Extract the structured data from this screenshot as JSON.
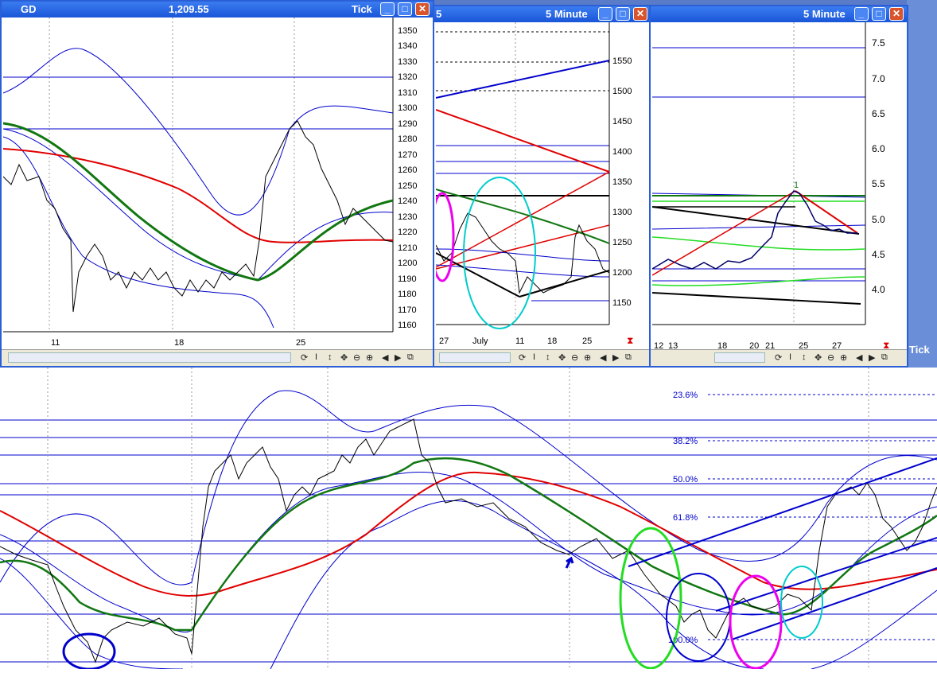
{
  "window1": {
    "symbol": "GD",
    "price": "1,209.55",
    "mode": "Tick",
    "y_ticks": [
      "1350",
      "1340",
      "1330",
      "1320",
      "1310",
      "1300",
      "1290",
      "1280",
      "1270",
      "1260",
      "1250",
      "1240",
      "1230",
      "1220",
      "1210",
      "1200",
      "1190",
      "1180",
      "1170",
      "1160"
    ],
    "x_ticks": [
      "11",
      "18",
      "25"
    ]
  },
  "window2": {
    "title_left": "5",
    "interval": "5 Minute",
    "y_ticks": [
      "1550",
      "1500",
      "1450",
      "1400",
      "1350",
      "1300",
      "1250",
      "1200",
      "1150"
    ],
    "x_ticks": [
      "27",
      "July",
      "11",
      "18",
      "25"
    ]
  },
  "window3": {
    "interval": "5 Minute",
    "y_ticks": [
      "7.5",
      "7.0",
      "6.5",
      "6.0",
      "5.5",
      "5.0",
      "4.5",
      "4.0"
    ],
    "x_ticks": [
      "12",
      "13",
      "18",
      "20",
      "21",
      "25",
      "27"
    ],
    "wave_label": "1"
  },
  "desktop": {
    "tick_label": "Tick"
  },
  "toolbar": {
    "refresh_icon": "refresh-icon",
    "cursor_icon": "text-cursor-icon",
    "vertical_move_icon": "vertical-move-icon",
    "move_icon": "move-icon",
    "zoom_out_icon": "zoom-out-icon",
    "zoom_in_icon": "zoom-in-icon"
  },
  "main_chart": {
    "fib_labels": [
      "23.6%",
      "38.2%",
      "50.0%",
      "61.8%",
      "100.0%"
    ]
  },
  "colors": {
    "title_blue": "#1a56d8",
    "price": "#000000",
    "upper_band": "#0000cc",
    "red_ma": "#e00000",
    "green_ma": "#117711",
    "bright_green": "#22dd22",
    "cyan": "#00cccc",
    "magenta": "#ee00ee"
  }
}
